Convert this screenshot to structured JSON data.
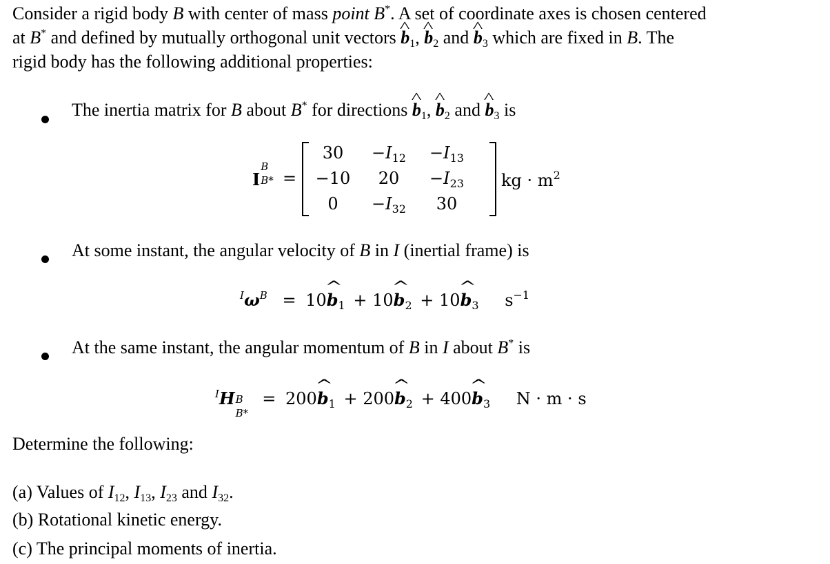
{
  "intro": {
    "line1": "Consider a rigid body B with center of mass point B*. A set of coordinate axes is chosen centered",
    "line1_parts": [
      "Consider a rigid body ",
      "B",
      " with center of mass ",
      "point B",
      "*",
      ". A set of coordinate axes is chosen centered"
    ],
    "line2_parts": [
      "at ",
      "B",
      "*",
      " and defined by mutually orthogonal unit vectors ",
      "b",
      "1",
      ", ",
      "b",
      "2",
      " and ",
      "b",
      "3",
      " which are fixed in ",
      "B",
      ". The"
    ],
    "line3": "rigid body has the following additional properties:"
  },
  "bullets": [
    {
      "text_parts": [
        "The inertia matrix for ",
        "B",
        " about ",
        "B",
        "*",
        " for directions ",
        "b",
        "1",
        ", ",
        "b",
        "2",
        " and ",
        "b",
        "3",
        " is"
      ]
    },
    {
      "text_parts": [
        "At some instant, the angular velocity of ",
        "B",
        " in ",
        "I",
        " (inertial frame) is"
      ]
    },
    {
      "text_parts": [
        "At the same instant, the angular momentum of ",
        "B",
        " in ",
        "I",
        " about ",
        "B",
        "*",
        " is"
      ]
    }
  ],
  "inertia_equation": {
    "lhs_symbol": "I",
    "lhs_sup": "B",
    "lhs_sub": "B*",
    "equals": "=",
    "matrix": [
      [
        "30",
        "−I12",
        "−I13"
      ],
      [
        "−10",
        "20",
        "−I23"
      ],
      [
        "0",
        "−I32",
        "30"
      ]
    ],
    "matrix_display": [
      [
        {
          "pre": "30",
          "sub": ""
        },
        {
          "pre": "−I",
          "sub": "12"
        },
        {
          "pre": "−I",
          "sub": "13"
        }
      ],
      [
        {
          "pre": "−10",
          "sub": ""
        },
        {
          "pre": "20",
          "sub": ""
        },
        {
          "pre": "−I",
          "sub": "23"
        }
      ],
      [
        {
          "pre": "0",
          "sub": ""
        },
        {
          "pre": "−I",
          "sub": "32"
        },
        {
          "pre": "30",
          "sub": ""
        }
      ]
    ],
    "units": "kg · m",
    "units_sup": "2"
  },
  "angular_velocity": {
    "lhs_pre": "I",
    "lhs_symbol": "ω",
    "lhs_sup": "B",
    "equals": "=",
    "terms": [
      {
        "coef": "10",
        "vec": "b",
        "idx": "1"
      },
      {
        "coef": "10",
        "vec": "b",
        "idx": "2"
      },
      {
        "coef": "10",
        "vec": "b",
        "idx": "3"
      }
    ],
    "plus": "+",
    "units": "s",
    "units_sup": "−1"
  },
  "angular_momentum": {
    "lhs_pre": "I",
    "lhs_symbol": "H",
    "lhs_sup": "B",
    "lhs_sub": "B*",
    "equals": "=",
    "terms": [
      {
        "coef": "200",
        "vec": "b",
        "idx": "1"
      },
      {
        "coef": "200",
        "vec": "b",
        "idx": "2"
      },
      {
        "coef": "400",
        "vec": "b",
        "idx": "3"
      }
    ],
    "plus": "+",
    "units": "N · m · s"
  },
  "determine": {
    "heading": "Determine the following:",
    "items": [
      {
        "label": "(a) Values of ",
        "tail": ".",
        "symbols": [
          {
            "s": "I",
            "sub": "12"
          },
          {
            "s": "I",
            "sub": "13"
          },
          {
            "s": "I",
            "sub": "23"
          },
          {
            "s": "I",
            "sub": "32"
          }
        ],
        "sep": ", ",
        "last_sep": " and "
      },
      {
        "label": "(b) Rotational kinetic energy."
      },
      {
        "label": "(c) The principal moments of inertia."
      }
    ]
  }
}
